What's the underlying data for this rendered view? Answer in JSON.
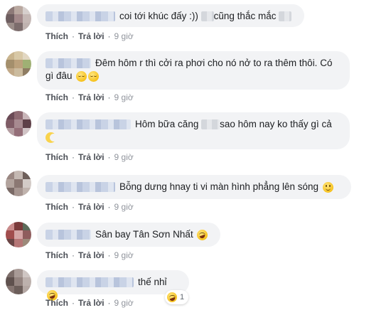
{
  "actions": {
    "like": "Thích",
    "reply": "Trả lời",
    "separator": "·"
  },
  "comments": [
    {
      "text": "coi tới khúc đấy :))",
      "text2": "cũng thắc mắc",
      "time": "9 giờ"
    },
    {
      "text": "Đêm hôm r thì cởi ra phơi cho nó nở to ra thêm thôi. Có",
      "text_line2": "gì đâu",
      "emojis": [
        "relieved-face-icon",
        "relieved-face-icon"
      ],
      "time": "9 giờ"
    },
    {
      "text": "Hôm bữa căng",
      "text2": "sao hôm nay ko thấy gì cả",
      "emojis": [
        "moon-face-icon"
      ],
      "time": "9 giờ"
    },
    {
      "text": "Bỗng dưng hnay ti vi màn hình phẳng lên sóng",
      "emojis": [
        "smile-face-icon"
      ],
      "time": "9 giờ"
    },
    {
      "text": "Sân bay Tân Sơn Nhất",
      "emojis": [
        "rofl-face-icon"
      ],
      "time": "9 giờ"
    },
    {
      "text": "thế nhỉ",
      "emojis": [
        "rofl-face-icon"
      ],
      "time": "9 giờ",
      "reaction": {
        "icon": "laughing-face-icon",
        "count": "1"
      }
    }
  ]
}
